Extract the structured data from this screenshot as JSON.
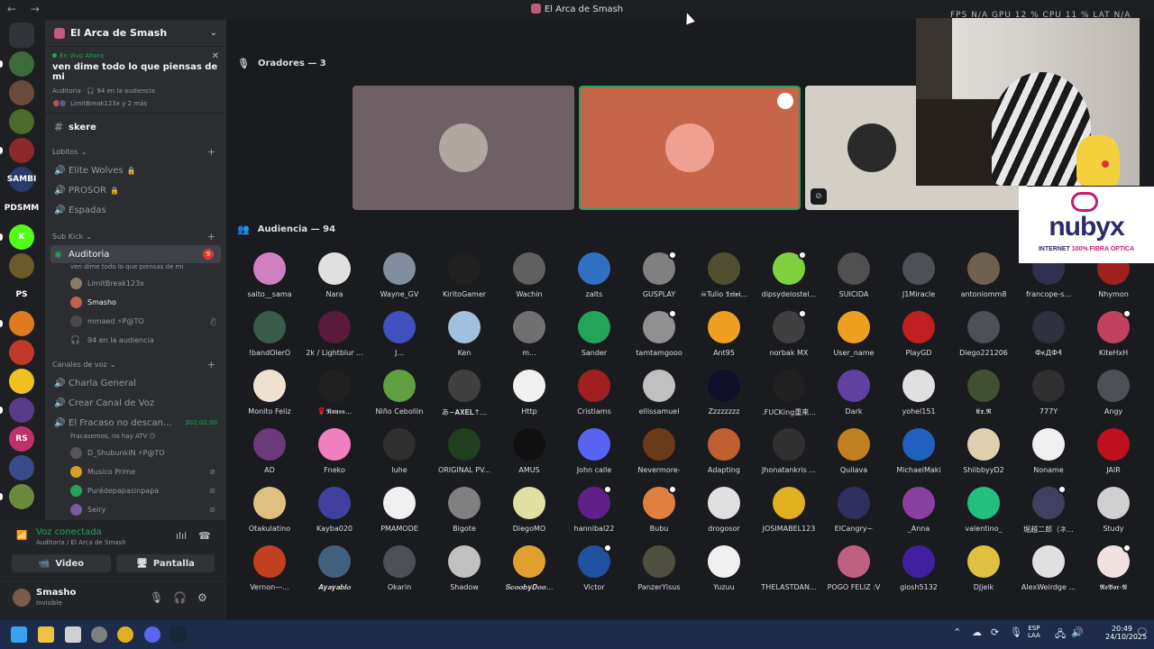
{
  "window": {
    "title": "El Arca de Smash",
    "back": "←",
    "forward": "→"
  },
  "overlay": {
    "fps": "FPS N/A    GPU 12 %    CPU 11 %    LAT N/A"
  },
  "rail": {
    "servers": [
      {
        "name": "discord-home",
        "label": "",
        "color": "#313338",
        "badge": ""
      },
      {
        "name": "server-1",
        "label": "",
        "color": "#3b6b3b",
        "badge": "4"
      },
      {
        "name": "server-2",
        "label": "",
        "color": "#6b4a3b",
        "badge": "2"
      },
      {
        "name": "server-3",
        "label": "",
        "color": "#4a6b2a",
        "badge": ""
      },
      {
        "name": "server-4",
        "label": "",
        "color": "#8a2a2a",
        "badge": "2"
      },
      {
        "name": "server-5",
        "label": "SAMBI",
        "color": "#2a3b6b",
        "badge": ""
      },
      {
        "name": "server-6",
        "label": "PDSMM",
        "color": "#1e1f22",
        "badge": ""
      },
      {
        "name": "server-7",
        "label": "K",
        "color": "#53fc18",
        "badge": ""
      },
      {
        "name": "server-8",
        "label": "",
        "color": "#6b5a2a",
        "badge": ""
      },
      {
        "name": "server-9",
        "label": "PS",
        "color": "#1e1f22",
        "badge": ""
      },
      {
        "name": "server-10",
        "label": "",
        "color": "#e07a20",
        "badge": ""
      },
      {
        "name": "server-11",
        "label": "",
        "color": "#c0392b",
        "badge": "12"
      },
      {
        "name": "server-12",
        "label": "",
        "color": "#f0c020",
        "badge": ""
      },
      {
        "name": "server-13",
        "label": "",
        "color": "#5a3b8a",
        "badge": ""
      },
      {
        "name": "server-14",
        "label": "RS",
        "color": "#c0306a",
        "badge": ""
      },
      {
        "name": "server-15",
        "label": "",
        "color": "#3b4a8a",
        "badge": ""
      },
      {
        "name": "server-16",
        "label": "",
        "color": "#6b8a3b",
        "badge": ""
      }
    ]
  },
  "sidebar": {
    "guild_name": "El Arca de Smash",
    "live": {
      "label": "En Vivo Ahora",
      "topic": "ven dime todo lo que piensas de mi",
      "meta": "Auditoria  ·  🎧 94 en la audiencia",
      "people": "LimitBreak123x y 2 más"
    },
    "channel_skere": "skere",
    "cat_lobitos": "Lobitos",
    "lobitos": [
      {
        "label": "Elite Wolves",
        "lock": "🔒"
      },
      {
        "label": "PROSOR",
        "lock": "🔒"
      },
      {
        "label": "Espadas",
        "lock": ""
      }
    ],
    "cat_subkick": "Sub Kick",
    "auditoria": {
      "label": "Auditoria",
      "badge": "9",
      "sub": "ven dime todo lo que piensas de mi",
      "members": [
        {
          "name": "LimitBreak123x",
          "color": "#8a7a6a",
          "bright": false
        },
        {
          "name": "Smasho",
          "color": "#c0604a",
          "bright": true
        },
        {
          "name": "mmaed  ⚡P@TO",
          "color": "#4a4a4a",
          "bright": false
        }
      ],
      "audience": "94 en la audiencia"
    },
    "cat_voz": "Canales de voz",
    "voz": [
      {
        "label": "Charla General"
      },
      {
        "label": "Crear Canal de Voz"
      },
      {
        "label": "El Fracaso no descan..."
      }
    ],
    "fracaso_timer": "302:02:00",
    "fracaso_sub": "Fracasemos, no hay ATV 😏",
    "fracaso_members": [
      {
        "name": "D_ShubunkiN  ⚡P@TO",
        "color": "#555"
      },
      {
        "name": "Musico Prime",
        "color": "#d4a020"
      },
      {
        "name": "Purédepapasinpapa",
        "color": "#23a559"
      },
      {
        "name": "Seiry",
        "color": "#7a5aa0"
      }
    ]
  },
  "voice": {
    "status": "Voz conectada",
    "where": "Auditoria / El Arca de Smash",
    "video": "Video",
    "screen": "Pantalla"
  },
  "user": {
    "name": "Smasho",
    "status": "Invisible"
  },
  "stage": {
    "speakers_header": "Oradores — 3",
    "audience_header": "Audiencia — 94"
  },
  "speakers": [
    {
      "color": "#6e6065",
      "face": "#b0a8a0",
      "border": "none"
    },
    {
      "color": "#c5664a",
      "face": "#f0a090",
      "border": "#23a559"
    },
    {
      "color": "#d4cfc6",
      "face": "#2a2a2a",
      "border": "none"
    }
  ],
  "audience": [
    [
      "saito__sama",
      "#d080c0"
    ],
    [
      "Nara",
      "#e0e0e0"
    ],
    [
      "Wayne_GV",
      "#8090a0"
    ],
    [
      "KiritoGamer",
      "#202020"
    ],
    [
      "Wachin",
      "#606060"
    ],
    [
      "zalts",
      "#3070c0"
    ],
    [
      "GUSPLAY",
      "#808080"
    ],
    [
      "☠Tulio 𝕿𝖗𝖎𝖛𝖎...",
      "#505030"
    ],
    [
      "dipsydelostel...",
      "#80d040"
    ],
    [
      "SUICIDA",
      "#505050"
    ],
    [
      "J1Miracle",
      "#4e5058"
    ],
    [
      "antoniomm8",
      "#706050"
    ],
    [
      "francope-s...",
      "#303050"
    ],
    [
      "Nhymon",
      "#a02020"
    ],
    [
      "!bandOlerO",
      "#3a5a4a"
    ],
    [
      "2k / Lightblur ...",
      "#5a1a3a"
    ],
    [
      "J...",
      "#4050c0"
    ],
    [
      "Ken",
      "#a0c0e0"
    ],
    [
      "m...",
      "#707070"
    ],
    [
      "Sander",
      "#23a559"
    ],
    [
      "tamtamgooo",
      "#909090"
    ],
    [
      "Ant95",
      "#f0a020"
    ],
    [
      "norbak MX",
      "#404040"
    ],
    [
      "User_name",
      "#f0a020"
    ],
    [
      "PlayGD",
      "#c02020"
    ],
    [
      "Diego221206",
      "#4e5058"
    ],
    [
      "ФкДФ₰",
      "#303040"
    ],
    [
      "KiteHxH",
      "#c04060"
    ],
    [
      "Monito Feliz",
      "#f0e0d0"
    ],
    [
      "🌹𝕹𝖔𝖚𝖘𝖘...",
      "#202020"
    ],
    [
      "Niño Cebollin",
      "#60a040"
    ],
    [
      "あ~𝐀𝐗𝐄𝐋↑...",
      "#404040"
    ],
    [
      "Http",
      "#f0f0f0"
    ],
    [
      "Cristiams",
      "#a02020"
    ],
    [
      "ellissamuel",
      "#c0c0c0"
    ],
    [
      "Zzzzzzzz",
      "#10102a"
    ],
    [
      ".FUCKing重来...",
      "#202020"
    ],
    [
      "Dark",
      "#6040a0"
    ],
    [
      "yohel151",
      "#e0e0e0"
    ],
    [
      "𝕰𝖝.𝕽",
      "#405030"
    ],
    [
      "777Y",
      "#303030"
    ],
    [
      "Angy",
      "#4e5058"
    ],
    [
      "AD",
      "#6a3a7a"
    ],
    [
      "Fneko",
      "#f080c0"
    ],
    [
      "luhe",
      "#303030"
    ],
    [
      "ORIGINAL PV...",
      "#204020"
    ],
    [
      "AMUS",
      "#101010"
    ],
    [
      "John calle",
      "#5865f2"
    ],
    [
      "Nevermore-",
      "#6a3a1a"
    ],
    [
      "Adapting",
      "#c06030"
    ],
    [
      "Jhonatankris ...",
      "#303030"
    ],
    [
      "Quilava",
      "#c08020"
    ],
    [
      "MichaelMaki",
      "#2060c0"
    ],
    [
      "ShiibbyyD2",
      "#e0d0b0"
    ],
    [
      "Noname",
      "#f0f0f0"
    ],
    [
      "JAIR",
      "#c01020"
    ],
    [
      "Otakulatino",
      "#e0c080"
    ],
    [
      "Kayba020",
      "#4040a0"
    ],
    [
      "PMAMODE",
      "#f0f0f0"
    ],
    [
      "Bigote",
      "#808080"
    ],
    [
      "DiegoMO",
      "#e0e0a0"
    ],
    [
      "hannibal22",
      "#60208a"
    ],
    [
      "Bubu",
      "#e08040"
    ],
    [
      "drogosor",
      "#e0e0e0"
    ],
    [
      "JOSIMABEL123",
      "#e0b020"
    ],
    [
      "ElCangry~",
      "#303060"
    ],
    [
      "_Anna",
      "#8a40a0"
    ],
    [
      "valentino_",
      "#20c080"
    ],
    [
      "堀越二郎（ネ...",
      "#404060"
    ],
    [
      "Study",
      "#d0d0d0"
    ],
    [
      "Vernon—...",
      "#c04020"
    ],
    [
      "𝑨𝒚𝒂𝒚𝒂𝒃𝒍𝒐",
      "#406080"
    ],
    [
      "Okarin",
      "#4e5058"
    ],
    [
      "Shadow",
      "#c0c0c0"
    ],
    [
      "𝑺𝒄𝒐𝒐𝒃𝒚𝑫𝒐𝒐...",
      "#e0a030"
    ],
    [
      "Victor",
      "#2050a0"
    ],
    [
      "PanzerYisus",
      "#505040"
    ],
    [
      "Yuzuu",
      "#f0f0f0"
    ],
    [
      "THELASTDAN...",
      "#1a1b1e"
    ],
    [
      "POGO FELIZ :V",
      "#c06080"
    ],
    [
      "giosh5132",
      "#4020a0"
    ],
    [
      "DJjeik",
      "#e0c040"
    ],
    [
      "AlexWeirdge ...",
      "#e0e0e0"
    ],
    [
      "𝕽𝖊𝕭𝖔𝖗-𝕹",
      "#f0e0e0"
    ]
  ],
  "ad": {
    "brand": "nubyx",
    "tagline_a": "INTERNET ",
    "tagline_b": "100% FIBRA ÓPTICA"
  },
  "taskbar": {
    "lang1": "ESP",
    "lang2": "LAA",
    "time": "20:49",
    "date": "24/10/2025"
  }
}
